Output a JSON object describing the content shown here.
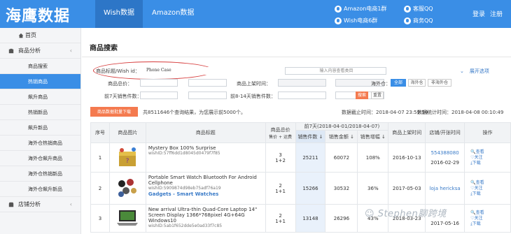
{
  "header": {
    "logo": "海鹰数据",
    "tabs": [
      {
        "label": "Wish数据"
      },
      {
        "label": "Amazon数据"
      }
    ],
    "groups": [
      {
        "label": "Amazon电商1群"
      },
      {
        "label": "Wish电商6群"
      }
    ],
    "service": [
      {
        "label": "客服QQ"
      },
      {
        "label": "商务QQ"
      }
    ],
    "login": "登录",
    "register": "注册"
  },
  "sidebar": {
    "home": "首页",
    "product_analysis": "商品分析",
    "items": [
      {
        "label": "商品搜索"
      },
      {
        "label": "热销商品"
      },
      {
        "label": "飙升商品"
      },
      {
        "label": "热销新品"
      },
      {
        "label": "飙升新品"
      },
      {
        "label": "海外仓热销商品"
      },
      {
        "label": "海外仓飙升商品"
      },
      {
        "label": "海外仓热销新品"
      },
      {
        "label": "海外仓飙升新品"
      }
    ],
    "store_analysis": "店铺分析"
  },
  "page": {
    "title": "商品搜索"
  },
  "search": {
    "title_label": "商品标题/Wish id：",
    "title_value": "Phone Case",
    "category_placeholder": "输入内容查看类目",
    "expand": "展开选项",
    "total_price": "商品总价：",
    "listed_time": "商品上架时间：",
    "overseas": "海外仓：",
    "overseas_all": "全部",
    "overseas_yes": "海外仓",
    "overseas_no": "非海外仓",
    "sales_7d": "前7天销售件数：",
    "sales_8_14": "前8-14天销售件数：",
    "search_btn": "搜索",
    "reset_btn": "重置"
  },
  "results": {
    "download_btn": "商品数据批量下载",
    "summary": "共8511646个查询结果，为您展示前5000个。",
    "data_cutoff": "数据截止时间：2018-04-07 23:59:59",
    "stat_time": "数据统计时间：2018-04-08 00:10:49"
  },
  "table": {
    "headers": {
      "index": "序号",
      "image": "商品图片",
      "title": "商品标题",
      "price": "商品总价",
      "price_sub": "售价 + 运费",
      "period": "前7天(2018-04-01/2018-04-07)",
      "sales_count": "销售件数 ↓",
      "sales_amount": "销售金额 ↓",
      "growth": "销售增幅 ↓",
      "listed": "商品上架时间",
      "store": "店铺/开张时间",
      "ops": "操作"
    },
    "rows": [
      {
        "index": "1",
        "title": "Mystery Box 100% Surprise",
        "wishid": "wishID:57ff6dd1d8045d0479f7f85",
        "price": "3",
        "price_sub": "1+2",
        "sales": "25211",
        "amount": "60072",
        "growth": "108%",
        "listed": "2016-10-13",
        "store": "554388080",
        "store_date": "2016-02-29"
      },
      {
        "index": "2",
        "title": "Portable Smart Watch Bluetooth For Android Cellphone",
        "wishid": "wishID:5909874d98eb75adf76a19",
        "tag": "Gadgets - Smart Watches",
        "price": "2",
        "price_sub": "1+1",
        "sales": "15266",
        "amount": "30532",
        "growth": "36%",
        "listed": "2017-05-03",
        "store": "loja hericksa",
        "store_date": ""
      },
      {
        "index": "3",
        "title": "New arrival Ultra-thin Quad-Core Laptop 14\" Screen Display 1366*768pixel 4G+64G Windows10",
        "wishid": "wishID:5ab1f652dde5e0ad33f7c85",
        "price": "2",
        "price_sub": "1+1",
        "sales": "13148",
        "amount": "26296",
        "growth": "43%",
        "listed": "2018-03-23",
        "store": "",
        "store_date": "2017-05-16"
      }
    ],
    "ops": [
      "查看",
      "关注",
      "下载"
    ]
  },
  "watermark": "Stephen聊跨境",
  "colors": {
    "brand": "#3a8ee6",
    "accent": "#f47a4f",
    "annotation": "#d63a3a"
  }
}
